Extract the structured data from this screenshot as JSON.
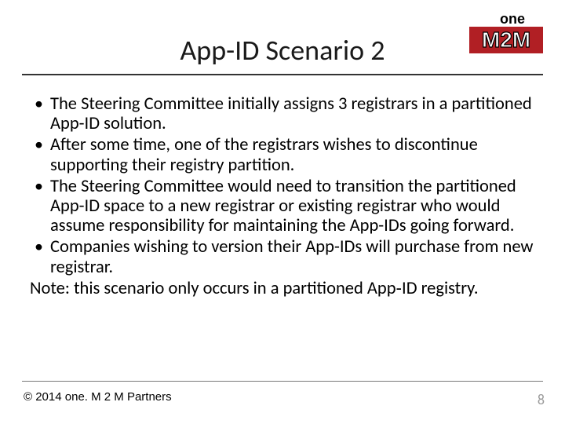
{
  "title": "App-ID Scenario 2",
  "logo": {
    "top_text": "one",
    "bottom_text": "M2M",
    "accent": "#b11f24"
  },
  "bullets": [
    "The Steering Committee initially assigns 3 registrars in a partitioned App-ID solution.",
    "After some time, one of the registrars wishes to discontinue supporting their registry partition.",
    "The Steering Committee would need to transition the partitioned App-ID space to a new registrar or existing registrar who would assume responsibility for maintaining the App-IDs going forward.",
    "Companies wishing to version their App-IDs will purchase from new registrar."
  ],
  "note": "Note: this scenario only occurs in a partitioned App‑ID registry.",
  "copyright": "© 2014 one. M 2 M Partners",
  "page_number": "8"
}
